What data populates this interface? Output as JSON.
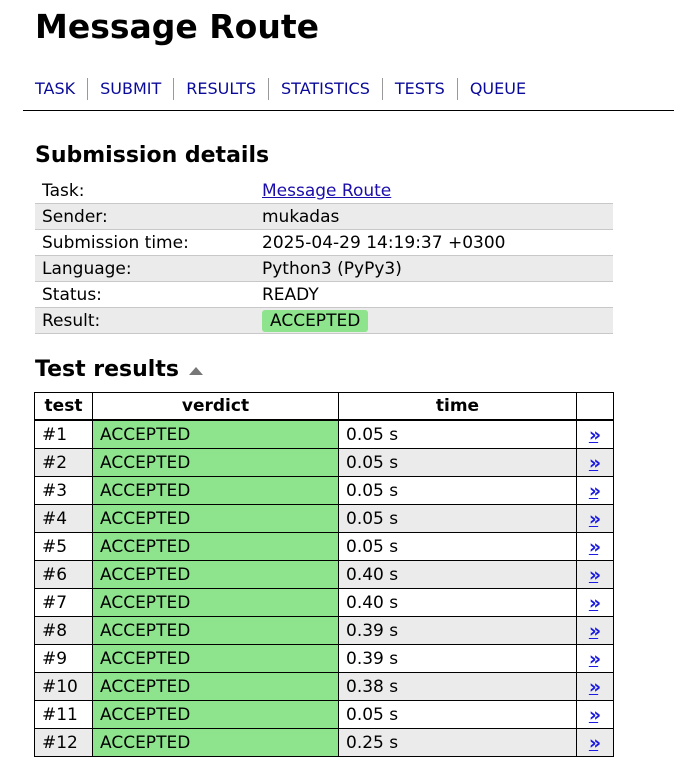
{
  "page": {
    "title": "Message Route"
  },
  "nav": {
    "items": [
      "TASK",
      "SUBMIT",
      "RESULTS",
      "STATISTICS",
      "TESTS",
      "QUEUE"
    ]
  },
  "details": {
    "heading": "Submission details",
    "task_label": "Task:",
    "task_value": "Message Route",
    "sender_label": "Sender:",
    "sender_value": "mukadas",
    "time_label": "Submission time:",
    "time_value": "2025-04-29 14:19:37 +0300",
    "language_label": "Language:",
    "language_value": "Python3 (PyPy3)",
    "status_label": "Status:",
    "status_value": "READY",
    "result_label": "Result:",
    "result_value": "ACCEPTED"
  },
  "tests": {
    "heading": "Test results",
    "col_test": "test",
    "col_verdict": "verdict",
    "col_time": "time",
    "link_glyph": "»",
    "rows": [
      {
        "test": "#1",
        "verdict": "ACCEPTED",
        "time": "0.05 s"
      },
      {
        "test": "#2",
        "verdict": "ACCEPTED",
        "time": "0.05 s"
      },
      {
        "test": "#3",
        "verdict": "ACCEPTED",
        "time": "0.05 s"
      },
      {
        "test": "#4",
        "verdict": "ACCEPTED",
        "time": "0.05 s"
      },
      {
        "test": "#5",
        "verdict": "ACCEPTED",
        "time": "0.05 s"
      },
      {
        "test": "#6",
        "verdict": "ACCEPTED",
        "time": "0.40 s"
      },
      {
        "test": "#7",
        "verdict": "ACCEPTED",
        "time": "0.40 s"
      },
      {
        "test": "#8",
        "verdict": "ACCEPTED",
        "time": "0.39 s"
      },
      {
        "test": "#9",
        "verdict": "ACCEPTED",
        "time": "0.39 s"
      },
      {
        "test": "#10",
        "verdict": "ACCEPTED",
        "time": "0.38 s"
      },
      {
        "test": "#11",
        "verdict": "ACCEPTED",
        "time": "0.05 s"
      },
      {
        "test": "#12",
        "verdict": "ACCEPTED",
        "time": "0.25 s"
      }
    ]
  },
  "colors": {
    "accepted": "#8de48d",
    "link": "#1a0dab",
    "nav": "#0a0a9a",
    "row_alt": "#ebebeb"
  }
}
